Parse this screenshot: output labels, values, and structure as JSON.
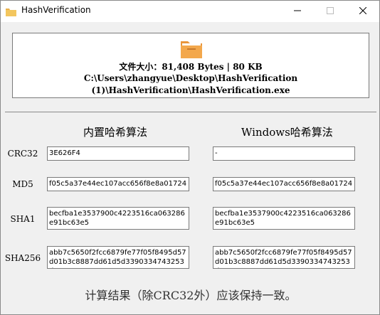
{
  "window": {
    "title": "HashVerification",
    "controls": {
      "minimize": "—",
      "maximize": "☐",
      "close": "✕"
    }
  },
  "file_info": {
    "icon": "folder-icon",
    "size_label": "文件大小：81,408 Bytes | 80 KB",
    "path_line1": "C:\\Users\\zhangyue\\Desktop\\HashVerification",
    "path_line2": "(1)\\HashVerification\\HashVerification.exe"
  },
  "columns": {
    "builtin": "内置哈希算法",
    "windows": "Windows哈希算法"
  },
  "rows": [
    {
      "label": "CRC32",
      "builtin": "3E626F4",
      "windows": "-"
    },
    {
      "label": "MD5",
      "builtin": "f05c5a37e44ec107acc656f8e8a01724",
      "windows": "f05c5a37e44ec107acc656f8e8a01724"
    },
    {
      "label": "SHA1",
      "builtin": "becfba1e3537900c4223516ca063286e91bc63e5",
      "windows": "becfba1e3537900c4223516ca063286e91bc63e5"
    },
    {
      "label": "SHA256",
      "builtin": "abb7c5650f2fcc6879fe77f05f8495d57d01b3c8887dd61d5d3390334743253d",
      "windows": "abb7c5650f2fcc6879fe77f05f8495d57d01b3c8887dd61d5d3390334743253d"
    }
  ],
  "footer": "计算结果（除CRC32外）应该保持一致。",
  "colors": {
    "accent": "#f0a04b",
    "background": "#f0f0f0"
  }
}
